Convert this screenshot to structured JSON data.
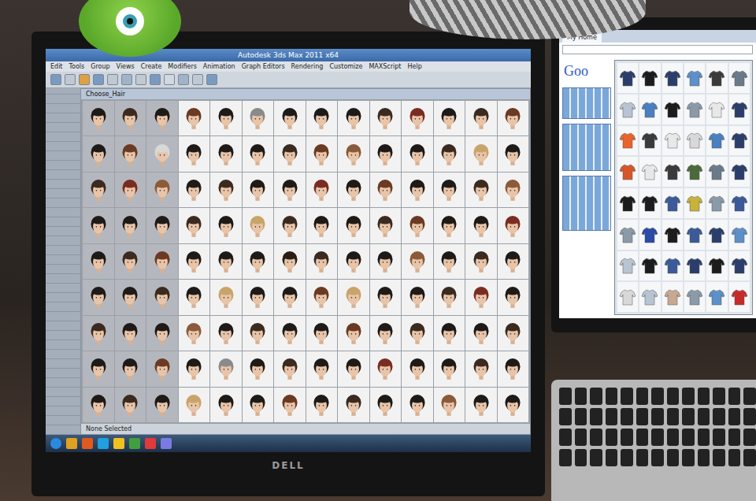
{
  "monitor_brand": "DELL",
  "app": {
    "title": "Autodesk 3ds Max 2011 x64",
    "menu": [
      "Edit",
      "Tools",
      "Group",
      "Views",
      "Create",
      "Modifiers",
      "Animation",
      "Graph Editors",
      "Rendering",
      "Customize",
      "MAXScript",
      "Help"
    ],
    "panel_title": "Choose_Hair",
    "status": "None Selected"
  },
  "hair_thumbnails": [
    {
      "color": "#1e1a18"
    },
    {
      "color": "#3b2a20"
    },
    {
      "color": "#1e1a18"
    },
    {
      "color": "#6b3a22"
    },
    {
      "color": "#1e1a18"
    },
    {
      "color": "#8a8a8a"
    },
    {
      "color": "#1e1a18"
    },
    {
      "color": "#1e1a18"
    },
    {
      "color": "#1e1a18"
    },
    {
      "color": "#3b2a20"
    },
    {
      "color": "#7a2c22"
    },
    {
      "color": "#1e1a18"
    },
    {
      "color": "#3b2a20"
    },
    {
      "color": "#6b3a22"
    },
    {
      "color": "#1e1a18"
    },
    {
      "color": "#6b3a22"
    },
    {
      "color": "#d8d8d8"
    },
    {
      "color": "#1e1a18"
    },
    {
      "color": "#1e1a18"
    },
    {
      "color": "#1e1a18"
    },
    {
      "color": "#3b2a20"
    },
    {
      "color": "#6b3a22"
    },
    {
      "color": "#8a5a3a"
    },
    {
      "color": "#1e1a18"
    },
    {
      "color": "#1e1a18"
    },
    {
      "color": "#3b2a20"
    },
    {
      "color": "#c9a46a"
    },
    {
      "color": "#1e1a18"
    },
    {
      "color": "#3b2a20"
    },
    {
      "color": "#7a2c22"
    },
    {
      "color": "#8a5a3a"
    },
    {
      "color": "#1e1a18"
    },
    {
      "color": "#3b2a20"
    },
    {
      "color": "#1e1a18"
    },
    {
      "color": "#1e1a18"
    },
    {
      "color": "#7a2c22"
    },
    {
      "color": "#1e1a18"
    },
    {
      "color": "#6b3a22"
    },
    {
      "color": "#1e1a18"
    },
    {
      "color": "#1e1a18"
    },
    {
      "color": "#3b2a20"
    },
    {
      "color": "#8a5a3a"
    },
    {
      "color": "#1e1a18"
    },
    {
      "color": "#1e1a18"
    },
    {
      "color": "#1e1a18"
    },
    {
      "color": "#3b2a20"
    },
    {
      "color": "#1e1a18"
    },
    {
      "color": "#c9a46a"
    },
    {
      "color": "#3b2a20"
    },
    {
      "color": "#1e1a18"
    },
    {
      "color": "#1e1a18"
    },
    {
      "color": "#3b2a20"
    },
    {
      "color": "#6b3a22"
    },
    {
      "color": "#1e1a18"
    },
    {
      "color": "#1e1a18"
    },
    {
      "color": "#7a2c22"
    },
    {
      "color": "#1e1a18"
    },
    {
      "color": "#3b2a20"
    },
    {
      "color": "#6b3a22"
    },
    {
      "color": "#1e1a18"
    },
    {
      "color": "#1e1a18"
    },
    {
      "color": "#1e1a18"
    },
    {
      "color": "#2a1d16"
    },
    {
      "color": "#3b2a20"
    },
    {
      "color": "#1e1a18"
    },
    {
      "color": "#1e1a18"
    },
    {
      "color": "#8a5a3a"
    },
    {
      "color": "#1e1a18"
    },
    {
      "color": "#3b2a20"
    },
    {
      "color": "#1e1a18"
    },
    {
      "color": "#1e1a18"
    },
    {
      "color": "#1e1a18"
    },
    {
      "color": "#3b2a20"
    },
    {
      "color": "#1e1a18"
    },
    {
      "color": "#c9a46a"
    },
    {
      "color": "#1e1a18"
    },
    {
      "color": "#1e1a18"
    },
    {
      "color": "#6b3a22"
    },
    {
      "color": "#c9a46a"
    },
    {
      "color": "#1e1a18"
    },
    {
      "color": "#1e1a18"
    },
    {
      "color": "#3b2a20"
    },
    {
      "color": "#7a2c22"
    },
    {
      "color": "#1e1a18"
    },
    {
      "color": "#3b2a20"
    },
    {
      "color": "#1e1a18"
    },
    {
      "color": "#1e1a18"
    },
    {
      "color": "#8a5a3a"
    },
    {
      "color": "#1e1a18"
    },
    {
      "color": "#3b2a20"
    },
    {
      "color": "#1e1a18"
    },
    {
      "color": "#1e1a18"
    },
    {
      "color": "#6b3a22"
    },
    {
      "color": "#1e1a18"
    },
    {
      "color": "#3b2a20"
    },
    {
      "color": "#1e1a18"
    },
    {
      "color": "#1e1a18"
    },
    {
      "color": "#3b2a20"
    },
    {
      "color": "#1e1a18"
    },
    {
      "color": "#1e1a18"
    },
    {
      "color": "#6b3a22"
    },
    {
      "color": "#1e1a18"
    },
    {
      "color": "#8a8a8a"
    },
    {
      "color": "#1e1a18"
    },
    {
      "color": "#3b2a20"
    },
    {
      "color": "#1e1a18"
    },
    {
      "color": "#1e1a18"
    },
    {
      "color": "#7a2c22"
    },
    {
      "color": "#1e1a18"
    },
    {
      "color": "#1e1a18"
    },
    {
      "color": "#3b2a20"
    },
    {
      "color": "#1e1a18"
    },
    {
      "color": "#1e1a18"
    },
    {
      "color": "#3b2a20"
    },
    {
      "color": "#1e1a18"
    },
    {
      "color": "#c9a46a"
    },
    {
      "color": "#1e1a18"
    },
    {
      "color": "#1e1a18"
    },
    {
      "color": "#6b3a22"
    },
    {
      "color": "#1e1a18"
    },
    {
      "color": "#3b2a20"
    },
    {
      "color": "#1e1a18"
    },
    {
      "color": "#1e1a18"
    },
    {
      "color": "#8a5a3a"
    },
    {
      "color": "#1e1a18"
    },
    {
      "color": "#1e1a18"
    }
  ],
  "browser": {
    "tab": "My Home",
    "logo": "Goo"
  },
  "clothing_thumbnails": [
    {
      "color": "#2b3e6b"
    },
    {
      "color": "#1c1c1c"
    },
    {
      "color": "#2b3e6b"
    },
    {
      "color": "#5d8fc9"
    },
    {
      "color": "#3a3a3a"
    },
    {
      "color": "#6a7a8a"
    },
    {
      "color": "#b8c4d2"
    },
    {
      "color": "#4a7fc1"
    },
    {
      "color": "#1c1c1c"
    },
    {
      "color": "#8a9aa8"
    },
    {
      "color": "#e8e8e8"
    },
    {
      "color": "#2b3e6b"
    },
    {
      "color": "#e8642c"
    },
    {
      "color": "#3a3a3a"
    },
    {
      "color": "#e8e8e8"
    },
    {
      "color": "#d8d8d8"
    },
    {
      "color": "#4a7fc1"
    },
    {
      "color": "#2b3e6b"
    },
    {
      "color": "#d8552a"
    },
    {
      "color": "#e8e8e8"
    },
    {
      "color": "#3a3a3a"
    },
    {
      "color": "#4a6a3a"
    },
    {
      "color": "#6a7a8a"
    },
    {
      "color": "#2b3e6b"
    },
    {
      "color": "#1c1c1c"
    },
    {
      "color": "#1c1c1c"
    },
    {
      "color": "#3a5a9a"
    },
    {
      "color": "#c9b23a"
    },
    {
      "color": "#8a9aa8"
    },
    {
      "color": "#3a5a9a"
    },
    {
      "color": "#8a9aa8"
    },
    {
      "color": "#2a4aa8"
    },
    {
      "color": "#1c1c1c"
    },
    {
      "color": "#3a5a9a"
    },
    {
      "color": "#2b3e6b"
    },
    {
      "color": "#5d8fc9"
    },
    {
      "color": "#b8c4d2"
    },
    {
      "color": "#1c1c1c"
    },
    {
      "color": "#3a5a9a"
    },
    {
      "color": "#2b3e6b"
    },
    {
      "color": "#1c1c1c"
    },
    {
      "color": "#2b3e6b"
    },
    {
      "color": "#d8d8d8"
    },
    {
      "color": "#b8c4d2"
    },
    {
      "color": "#c8a890"
    },
    {
      "color": "#8a9aa8"
    },
    {
      "color": "#5d8fc9"
    },
    {
      "color": "#c82a2a"
    }
  ]
}
